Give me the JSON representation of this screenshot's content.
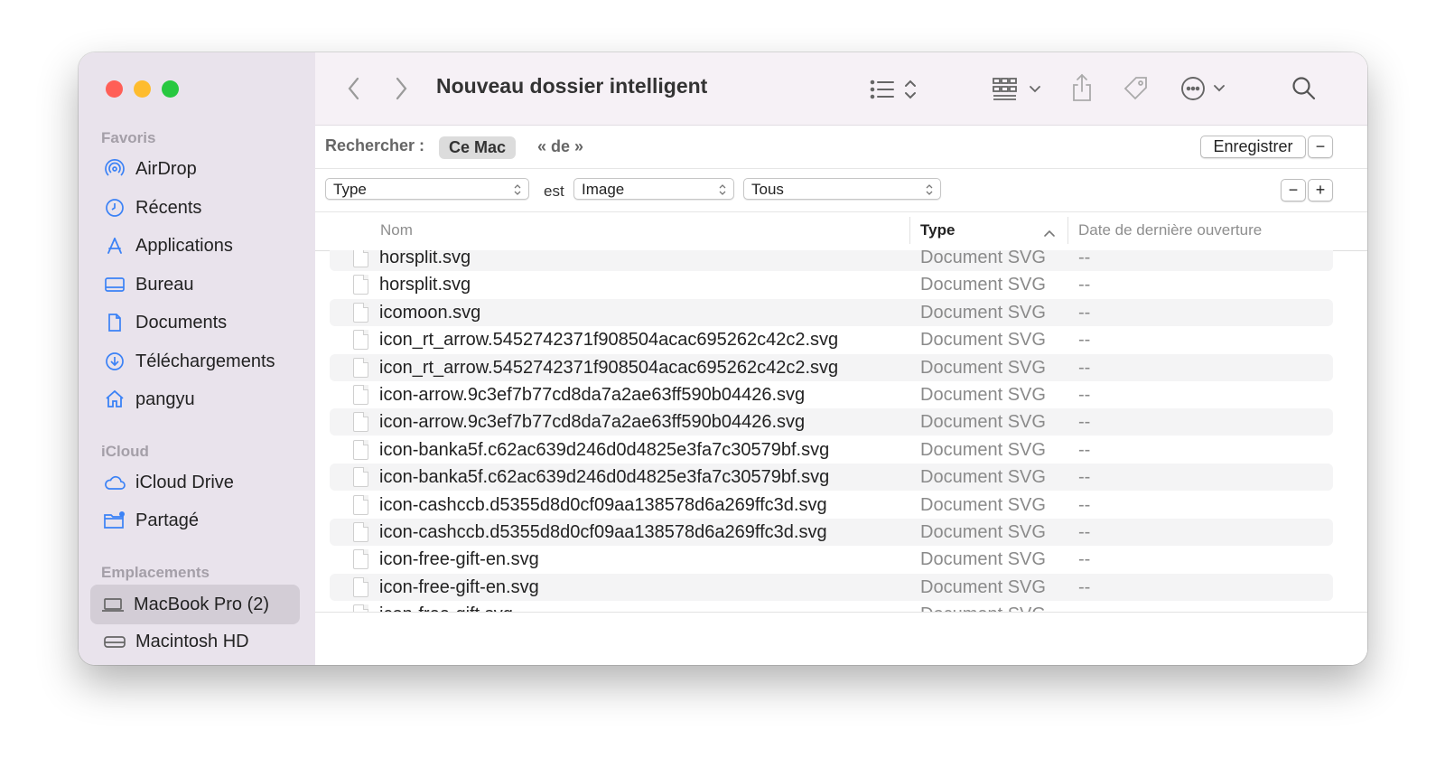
{
  "window": {
    "title": "Nouveau dossier intelligent",
    "traffic_lights": {
      "close": "#ff5f57",
      "minimize": "#febc2e",
      "zoom": "#28c840"
    }
  },
  "sidebar": {
    "sections": [
      {
        "title": "Favoris",
        "items": [
          {
            "label": "AirDrop",
            "icon": "airdrop-icon"
          },
          {
            "label": "Récents",
            "icon": "clock-icon"
          },
          {
            "label": "Applications",
            "icon": "applications-icon"
          },
          {
            "label": "Bureau",
            "icon": "desktop-icon"
          },
          {
            "label": "Documents",
            "icon": "document-icon"
          },
          {
            "label": "Téléchargements",
            "icon": "download-icon"
          },
          {
            "label": "pangyu",
            "icon": "home-icon"
          }
        ]
      },
      {
        "title": "iCloud",
        "items": [
          {
            "label": "iCloud Drive",
            "icon": "cloud-icon"
          },
          {
            "label": "Partagé",
            "icon": "shared-folder-icon"
          }
        ]
      },
      {
        "title": "Emplacements",
        "items": [
          {
            "label": "MacBook Pro (2)",
            "icon": "laptop-icon",
            "selected": true
          },
          {
            "label": "Macintosh HD",
            "icon": "disk-icon"
          }
        ]
      }
    ],
    "accent": "#3b82f6"
  },
  "toolbar": {
    "back_icon": "chevron-left-icon",
    "forward_icon": "chevron-right-icon",
    "view_icon": "list-view-icon",
    "group_icon": "grid-group-icon",
    "share_icon": "share-icon",
    "tag_icon": "tag-icon",
    "more_icon": "ellipsis-circle-icon",
    "search_icon": "search-icon"
  },
  "search": {
    "label": "Rechercher :",
    "scope_active": "Ce Mac",
    "scope_other": "« de »",
    "save_button": "Enregistrer",
    "remove_button": "−"
  },
  "criteria": {
    "attribute": "Type",
    "operator": "est",
    "value": "Image",
    "subtype": "Tous",
    "remove_button": "−",
    "add_button": "+"
  },
  "columns": {
    "name": "Nom",
    "type": "Type",
    "date": "Date de dernière ouverture",
    "sort_icon": "chevron-up-icon"
  },
  "files": [
    {
      "name": "horsplit.svg",
      "type": "Document SVG",
      "date": "--"
    },
    {
      "name": "horsplit.svg",
      "type": "Document SVG",
      "date": "--"
    },
    {
      "name": "icomoon.svg",
      "type": "Document SVG",
      "date": "--"
    },
    {
      "name": "icon_rt_arrow.5452742371f908504acac695262c42c2.svg",
      "type": "Document SVG",
      "date": "--"
    },
    {
      "name": "icon_rt_arrow.5452742371f908504acac695262c42c2.svg",
      "type": "Document SVG",
      "date": "--"
    },
    {
      "name": "icon-arrow.9c3ef7b77cd8da7a2ae63ff590b04426.svg",
      "type": "Document SVG",
      "date": "--"
    },
    {
      "name": "icon-arrow.9c3ef7b77cd8da7a2ae63ff590b04426.svg",
      "type": "Document SVG",
      "date": "--"
    },
    {
      "name": "icon-banka5f.c62ac639d246d0d4825e3fa7c30579bf.svg",
      "type": "Document SVG",
      "date": "--"
    },
    {
      "name": "icon-banka5f.c62ac639d246d0d4825e3fa7c30579bf.svg",
      "type": "Document SVG",
      "date": "--"
    },
    {
      "name": "icon-cashccb.d5355d8d0cf09aa138578d6a269ffc3d.svg",
      "type": "Document SVG",
      "date": "--"
    },
    {
      "name": "icon-cashccb.d5355d8d0cf09aa138578d6a269ffc3d.svg",
      "type": "Document SVG",
      "date": "--"
    },
    {
      "name": "icon-free-gift-en.svg",
      "type": "Document SVG",
      "date": "--"
    },
    {
      "name": "icon-free-gift-en.svg",
      "type": "Document SVG",
      "date": "--"
    },
    {
      "name": "icon-free-gift.svg",
      "type": "Document SVG",
      "date": ""
    }
  ]
}
